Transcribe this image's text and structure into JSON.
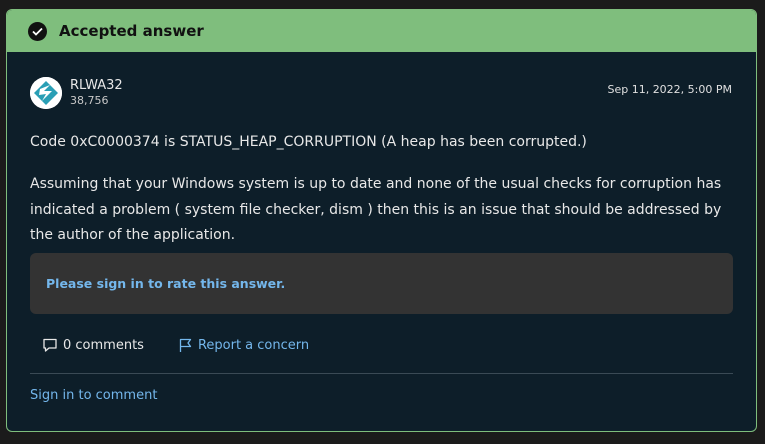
{
  "banner": {
    "label": "Accepted answer",
    "icon": "check-circle-icon"
  },
  "author": {
    "name": "RLWA32",
    "reputation": "38,756",
    "avatar_icon": "avatar-logo"
  },
  "timestamp": "Sep 11, 2022, 5:00 PM",
  "body": {
    "paragraph1": "Code 0xC0000374 is STATUS_HEAP_CORRUPTION (A heap has been corrupted.)",
    "paragraph2": "Assuming that your Windows system is up to date and none of the usual checks for corruption has indicated a problem ( system file checker, dism ) then this is an issue that should be addressed by the author of the application."
  },
  "rate": {
    "label": "Please sign in to rate this answer."
  },
  "actions": {
    "comments_label": "0 comments",
    "comments_icon": "comment-icon",
    "report_label": "Report a concern",
    "report_icon": "flag-icon"
  },
  "footer": {
    "sign_in_comment": "Sign in to comment"
  },
  "colors": {
    "accent_green": "#7fbe7d",
    "card_bg": "#0d1e29",
    "link_blue": "#74b7ec"
  }
}
